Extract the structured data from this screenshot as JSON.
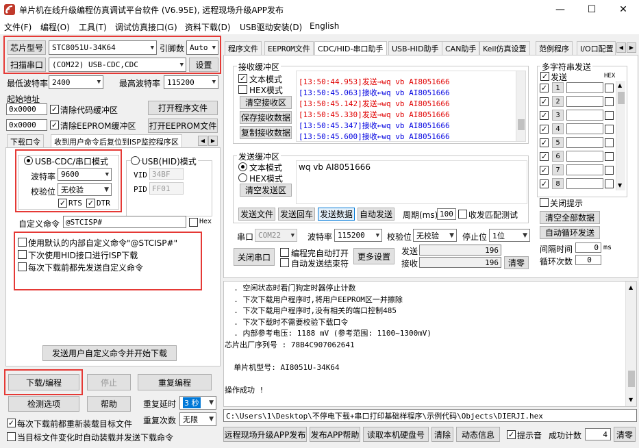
{
  "window": {
    "title": "单片机在线升级编程仿真调试平台软件 (V6.95E), 远程现场升级APP发布",
    "min": "—",
    "max": "☐",
    "close": "✕"
  },
  "menu": [
    "文件(F)",
    "编程(O)",
    "工具(T)",
    "调试仿真接口(G)",
    "资料下载(D)",
    "USB驱动安装(D)",
    "English"
  ],
  "left": {
    "chip_btn": "芯片型号",
    "chip_value": "STC8051U-34K64",
    "pin_label": "引脚数",
    "pin_value": "Auto",
    "scan_btn": "扫描串口",
    "port_value": "(COM22) USB-CDC,CDC",
    "settings_btn": "设置",
    "min_baud_label": "最低波特率",
    "min_baud_value": "2400",
    "max_baud_label": "最高波特率",
    "max_baud_value": "115200",
    "start_addr_label": "起始地址",
    "addr1": "0x0000",
    "clear_code_label": "清除代码缓冲区",
    "open_prog_btn": "打开程序文件",
    "addr2": "0x0000",
    "clear_eeprom_label": "清除EEPROM缓冲区",
    "open_eeprom_btn": "打开EEPROM文件",
    "tab1": "下载口令",
    "tab2": "收到用户命令后复位到ISP监控程序区",
    "usb_cdc_label": "USB-CDC/串口模式",
    "usb_hid_label": "USB(HID)模式",
    "baud_label": "波特率",
    "baud_value": "9600",
    "parity_label": "校验位",
    "parity_value": "无校验",
    "rts_label": "RTS",
    "dtr_label": "DTR",
    "vid_label": "VID",
    "vid_value": "34BF",
    "pid_label": "PID",
    "pid_value": "FF01",
    "custom_cmd_label": "自定义命令",
    "custom_cmd_value": "@STCISP#",
    "hex_label": "Hex",
    "opt1": "使用默认的内部自定义命令\"@STCISP#\"",
    "opt2": "下次使用HID接口进行ISP下载",
    "opt3": "每次下载前都先发送自定义命令",
    "send_custom_btn": "发送用户自定义命令并开始下载",
    "download_btn": "下载/编程",
    "stop_btn": "停止",
    "reprog_btn": "重复编程",
    "check_btn": "检测选项",
    "help_btn": "帮助",
    "delay_label": "重复延时",
    "delay_value": "3 秒",
    "count_label": "重复次数",
    "count_value": "无限",
    "reload_label": "每次下载前都重新装载目标文件",
    "auto_label": "当目标文件变化时自动装载并发送下载命令"
  },
  "tabs": [
    "程序文件",
    "EEPROM文件",
    "CDC/HID-串口助手",
    "USB-HID助手",
    "CAN助手",
    "Keil仿真设置",
    "范例程序",
    "I/O口配置"
  ],
  "serial": {
    "recv_title": "接收缓冲区",
    "text_mode": "文本模式",
    "hex_mode": "HEX模式",
    "clear_recv_btn": "清空接收区",
    "save_recv_btn": "保存接收数据",
    "copy_recv_btn": "复制接收数据",
    "recv_lines": [
      {
        "text": "[13:50:44.953]发送→wq vb AI8051666",
        "color": "#e00000"
      },
      {
        "text": "[13:50:45.063]接收←wq vb AI8051666",
        "color": "#0000e0"
      },
      {
        "text": "[13:50:45.142]发送→wq vb AI8051666",
        "color": "#e00000"
      },
      {
        "text": "[13:50:45.330]发送→wq vb AI8051666",
        "color": "#e00000"
      },
      {
        "text": "[13:50:45.347]接收←wq vb AI8051666",
        "color": "#0000e0"
      },
      {
        "text": "[13:50:45.600]接收←wq vb AI8051666",
        "color": "#0000e0"
      }
    ],
    "send_title": "发送缓冲区",
    "send_text_mode": "文本模式",
    "send_hex_mode": "HEX模式",
    "clear_send_btn": "清空发送区",
    "send_value": "wq vb AI8051666",
    "send_file_btn": "发送文件",
    "send_enter_btn": "发送回车",
    "send_data_btn": "发送数据",
    "auto_send_btn": "自动发送",
    "period_label": "周期(ms)",
    "period_value": "100",
    "loopback_label": "收发匹配测试",
    "port_label": "串口",
    "port_value": "COM22",
    "baud_label": "波特率",
    "baud_value": "115200",
    "parity_label": "校验位",
    "parity_value": "无校验",
    "stop_label": "停止位",
    "stop_value": "1位",
    "close_port_btn": "关闭串口",
    "auto_open_label": "编程完自动打开",
    "auto_stop_label": "自动发送结束符",
    "more_btn": "更多设置",
    "send_count_label": "发送",
    "send_count": "196",
    "recv_count_label": "接收",
    "recv_count": "196",
    "clear_count_btn": "清零"
  },
  "multi": {
    "title": "多字符串发送",
    "send_label": "发送",
    "hex_label": "HEX",
    "rows": [
      "1",
      "2",
      "3",
      "4",
      "5",
      "6",
      "7",
      "8"
    ],
    "close_hint_label": "关闭提示",
    "clear_all_btn": "清空全部数据",
    "auto_loop_btn": "自动循环发送",
    "interval_label": "间隔时间",
    "interval_value": "0",
    "interval_unit": "ms",
    "loop_count_label": "循环次数",
    "loop_count_value": "0"
  },
  "log": {
    "lines": [
      "  . 空闲状态时看门狗定时器停止计数",
      "  . 下次下载用户程序时,将用户EEPROM区一并擦除",
      "  . 下次下载用户程序时,没有相关的端口控制485",
      "  . 下次下载时不需要校验下载口令",
      "  . 内部参考电压: 1188 mV (参考范围: 1100~1300mV)",
      "芯片出厂序列号 : 78B4C907062641",
      "",
      "  单片机型号: AI8051U-34K64",
      "",
      "操作成功 !"
    ]
  },
  "bottom": {
    "path": "C:\\Users\\1\\Desktop\\不停电下载+串口打印基础样程序\\示例代码\\Objects\\DIERJI.hex",
    "publish_btn": "远程现场升级APP发布",
    "publish_help_btn": "发布APP帮助",
    "read_disk_btn": "读取本机硬盘号",
    "clear_btn": "清除",
    "anim_btn": "动态信息",
    "beep_label": "提示音",
    "success_label": "成功计数",
    "success_value": "4",
    "reset_btn": "清零"
  }
}
